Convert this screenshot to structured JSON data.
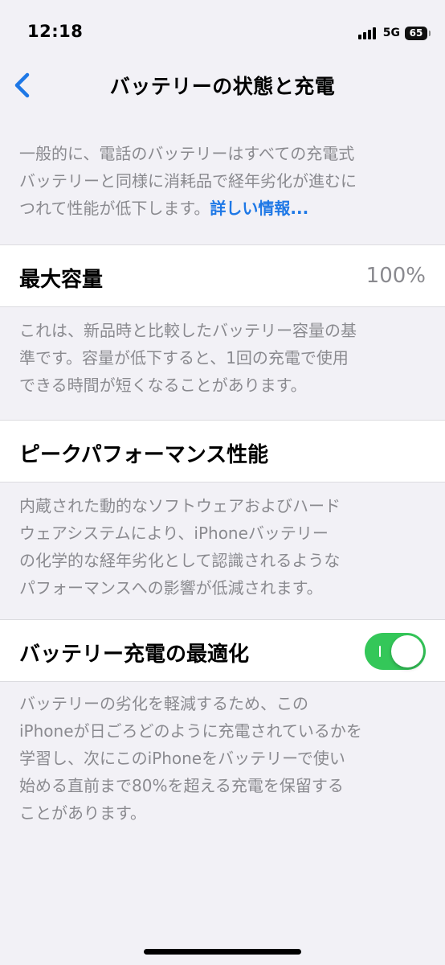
{
  "status_bar": {
    "time": "12:18",
    "network": "5G",
    "battery": "65"
  },
  "nav": {
    "title": "バッテリーの状態と充電",
    "back_icon": "chevron-left-icon",
    "accent_color": "#1e78e6"
  },
  "intro": {
    "lines": [
      "一般的に、電話のバッテリーはすべての充電式",
      "バッテリーと同様に消耗品で経年劣化が進むに",
      "つれて性能が低下します。"
    ],
    "link_label": "詳しい情報..."
  },
  "max_capacity": {
    "label": "最大容量",
    "value": "100%",
    "description": [
      "これは、新品時と比較したバッテリー容量の基",
      "準です。容量が低下すると、1回の充電で使用",
      "できる時間が短くなることがあります。"
    ]
  },
  "peak_performance": {
    "label": "ピークパフォーマンス性能",
    "description": [
      "内蔵された動的なソフトウェアおよびハード",
      "ウェアシステムにより、iPhoneバッテリー",
      "の化学的な経年劣化として認識されるような",
      "パフォーマンスへの影響が低減されます。"
    ]
  },
  "optimized_charging": {
    "label": "バッテリー充電の最適化",
    "enabled": true,
    "toggle_color": "#34c759",
    "description": [
      "バッテリーの劣化を軽減するため、この",
      "iPhoneが日ごろどのように充電されているかを",
      "学習し、次にこのiPhoneをバッテリーで使い",
      "始める直前まで80%を超える充電を保留する",
      "ことがあります。"
    ]
  }
}
